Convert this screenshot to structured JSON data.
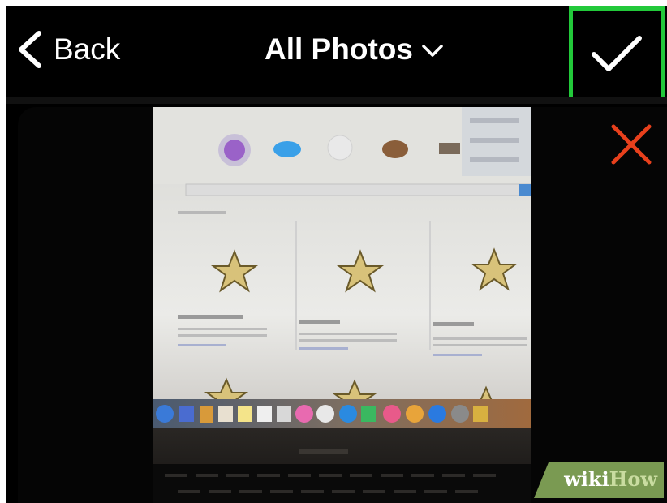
{
  "nav": {
    "back_label": "Back",
    "title": "All Photos"
  },
  "icons": {
    "back": "chevron-left-icon",
    "title_dropdown": "chevron-down-icon",
    "confirm": "checkmark-icon",
    "cancel": "close-icon"
  },
  "colors": {
    "highlight": "#22c93a",
    "cancel": "#e8401c",
    "background": "#000000"
  },
  "watermark": {
    "part1": "wiki",
    "part2": "How"
  }
}
